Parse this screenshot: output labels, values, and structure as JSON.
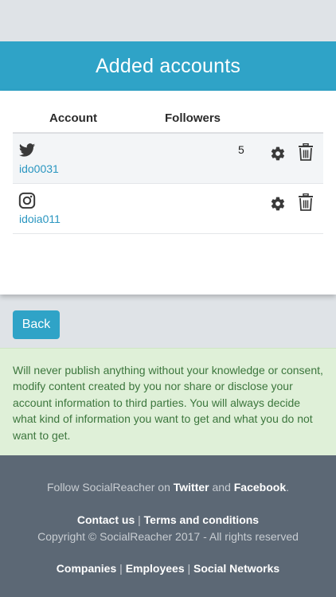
{
  "header": {
    "title": "Added accounts"
  },
  "table": {
    "col_account": "Account",
    "col_followers": "Followers",
    "rows": [
      {
        "network": "twitter-icon",
        "name": "ido0031",
        "followers": "5"
      },
      {
        "network": "instagram-icon",
        "name": "idoia011",
        "followers": ""
      }
    ]
  },
  "back_label": "Back",
  "notice": "Will never publish anything without your knowledge or consent, modify content created by you nor share or disclose your account information to third parties. You will always decide what kind of information you want to get and what you do not want to get.",
  "footer": {
    "follow_prefix": "Follow SocialReacher on",
    "twitter": "Twitter",
    "and": "and",
    "facebook": "Facebook",
    "period": ".",
    "contact": "Contact us",
    "terms": "Terms and conditions",
    "copyright": "Copyright © SocialReacher 2017 - All rights reserved",
    "companies": "Companies",
    "employees": "Employees",
    "social_networks": "Social Networks",
    "separator": "|"
  },
  "colors": {
    "accent": "#2fa3c7",
    "notice_bg": "#dff0d8",
    "notice_text": "#3c763d",
    "footer_bg": "#5c6875"
  }
}
